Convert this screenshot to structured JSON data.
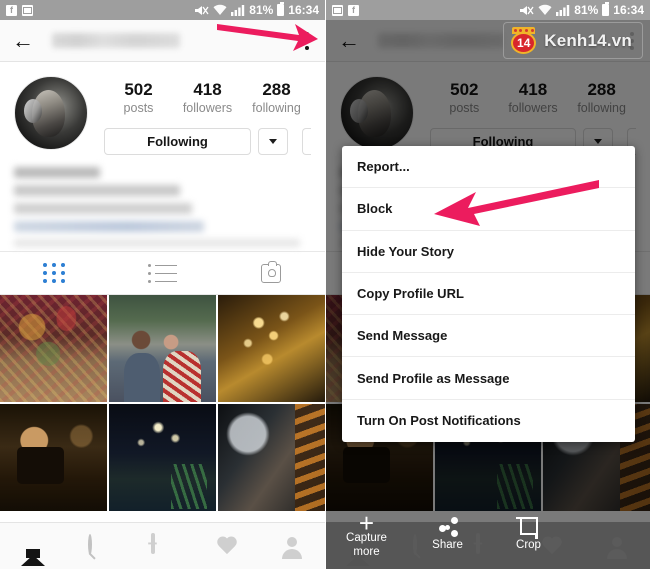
{
  "meta": {
    "accent_pink": "#EC1C5E",
    "ig_blue": "#2D7FD3",
    "status_gray": "#9E9E9E"
  },
  "status_bar": {
    "icons": [
      "facebook-icon",
      "screenshot-icon",
      "mute-icon",
      "wifi-icon",
      "signal-icon"
    ],
    "battery": "81%",
    "time": "16:34",
    "fb_glyph": "f"
  },
  "header": {
    "back_icon": "←",
    "username": "",
    "overflow_icon": "kebab-menu-icon"
  },
  "profile": {
    "stats": [
      {
        "num": "502",
        "label": "posts"
      },
      {
        "num": "418",
        "label": "followers"
      },
      {
        "num": "288",
        "label": "following"
      }
    ],
    "follow_button": "Following",
    "dropdown_icon": "chevron-down-icon"
  },
  "tabs": [
    {
      "name": "grid-tab",
      "icon": "grid-icon",
      "active": true
    },
    {
      "name": "list-tab",
      "icon": "list-icon",
      "active": false
    },
    {
      "name": "tagged-tab",
      "icon": "tagged-person-icon",
      "active": false
    }
  ],
  "grid": {
    "photos": [
      {
        "alt": "ornate-red-gold-textile"
      },
      {
        "alt": "couple-portrait-street"
      },
      {
        "alt": "golden-bokeh-lights"
      },
      {
        "alt": "dark-chocolate-cake"
      },
      {
        "alt": "night-city-rooftop"
      },
      {
        "alt": "night-market-scene"
      }
    ]
  },
  "bottom_nav": [
    {
      "name": "nav-home",
      "icon": "home-icon",
      "active": true
    },
    {
      "name": "nav-search",
      "icon": "search-icon",
      "active": false
    },
    {
      "name": "nav-add",
      "icon": "plus-square-icon",
      "active": false
    },
    {
      "name": "nav-activity",
      "icon": "heart-icon",
      "active": false
    },
    {
      "name": "nav-profile",
      "icon": "person-icon",
      "active": false
    }
  ],
  "menu": {
    "items": [
      "Report...",
      "Block",
      "Hide Your Story",
      "Copy Profile URL",
      "Send Message",
      "Send Profile as Message",
      "Turn On Post Notifications"
    ],
    "highlighted": "Block"
  },
  "watermark": {
    "badge_number": "14",
    "text": "Kenh14.vn"
  },
  "screenshot_toolbar": {
    "items": [
      {
        "label": "Capture\nmore",
        "label_line1": "Capture",
        "label_line2": "more",
        "icon": "plus-icon"
      },
      {
        "label": "Share",
        "label_line1": "Share",
        "label_line2": "",
        "icon": "share-icon"
      },
      {
        "label": "Crop",
        "label_line1": "Crop",
        "label_line2": "",
        "icon": "crop-icon"
      }
    ]
  },
  "annotations": [
    {
      "name": "arrow-to-overflow-menu",
      "panel": "left",
      "points_to": "kebab-menu-icon"
    },
    {
      "name": "arrow-to-block-item",
      "panel": "right",
      "points_to": "Block"
    }
  ]
}
